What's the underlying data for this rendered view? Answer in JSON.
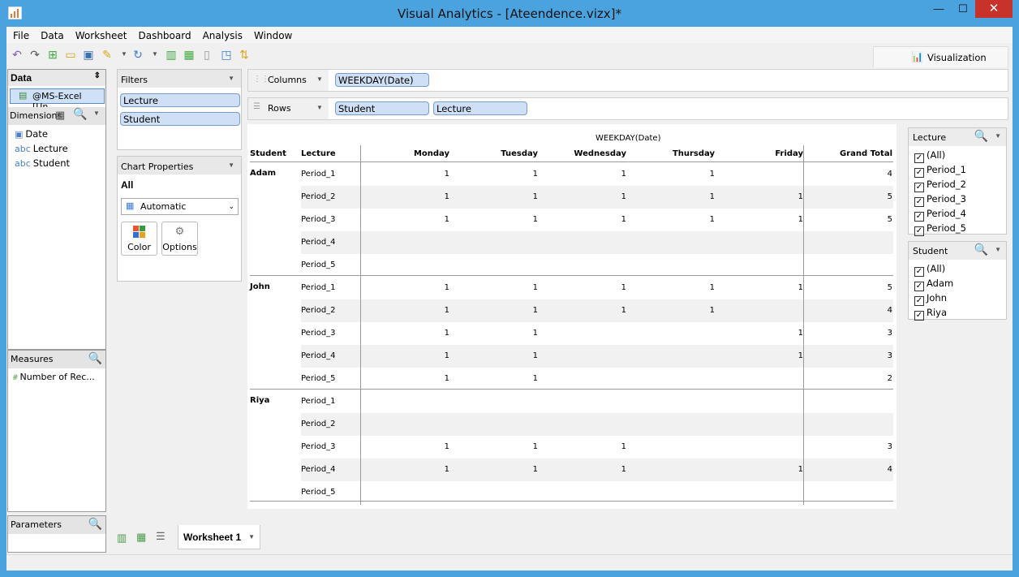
{
  "window": {
    "title": "Visual Analytics - [Ateendence.vizx]*",
    "minimize": "—",
    "maximize": "☐",
    "close": "✕"
  },
  "menu": [
    "File",
    "Data",
    "Worksheet",
    "Dashboard",
    "Analysis",
    "Window"
  ],
  "toolbar": {
    "viz_label": "Visualization"
  },
  "data_panel": {
    "header": "Data",
    "source": "@MS-Excel [Un...",
    "dimensions_label": "Dimensions",
    "dimensions": [
      {
        "type": "date",
        "label": "Date"
      },
      {
        "type": "abc",
        "label": "Lecture"
      },
      {
        "type": "abc",
        "label": "Student"
      }
    ],
    "measures_label": "Measures",
    "measures": [
      {
        "type": "num",
        "label": "Number of Rec..."
      }
    ],
    "parameters_label": "Parameters"
  },
  "filters": {
    "header": "Filters",
    "items": [
      "Lecture",
      "Student"
    ]
  },
  "chart_properties": {
    "header": "Chart Properties",
    "all_label": "All",
    "mark_type": "Automatic",
    "color_label": "Color",
    "options_label": "Options"
  },
  "shelves": {
    "columns_label": "Columns",
    "columns": [
      "WEEKDAY(Date)"
    ],
    "rows_label": "Rows",
    "rows": [
      "Student",
      "Lecture"
    ]
  },
  "table": {
    "top_header": "WEEKDAY(Date)",
    "headers": [
      "Student",
      "Lecture",
      "Monday",
      "Tuesday",
      "Wednesday",
      "Thursday",
      "Friday",
      "Grand Total"
    ],
    "groups": [
      {
        "student": "Adam",
        "rows": [
          {
            "lecture": "Period_1",
            "values": [
              "1",
              "1",
              "1",
              "1",
              "",
              "4"
            ]
          },
          {
            "lecture": "Period_2",
            "values": [
              "1",
              "1",
              "1",
              "1",
              "1",
              "5"
            ]
          },
          {
            "lecture": "Period_3",
            "values": [
              "1",
              "1",
              "1",
              "1",
              "1",
              "5"
            ]
          },
          {
            "lecture": "Period_4",
            "values": [
              "",
              "",
              "",
              "",
              "",
              ""
            ]
          },
          {
            "lecture": "Period_5",
            "values": [
              "",
              "",
              "",
              "",
              "",
              ""
            ]
          }
        ]
      },
      {
        "student": "John",
        "rows": [
          {
            "lecture": "Period_1",
            "values": [
              "1",
              "1",
              "1",
              "1",
              "1",
              "5"
            ]
          },
          {
            "lecture": "Period_2",
            "values": [
              "1",
              "1",
              "1",
              "1",
              "",
              "4"
            ]
          },
          {
            "lecture": "Period_3",
            "values": [
              "1",
              "1",
              "",
              "",
              "1",
              "3"
            ]
          },
          {
            "lecture": "Period_4",
            "values": [
              "1",
              "1",
              "",
              "",
              "1",
              "3"
            ]
          },
          {
            "lecture": "Period_5",
            "values": [
              "1",
              "1",
              "",
              "",
              "",
              "2"
            ]
          }
        ]
      },
      {
        "student": "Riya",
        "rows": [
          {
            "lecture": "Period_1",
            "values": [
              "",
              "",
              "",
              "",
              "",
              ""
            ]
          },
          {
            "lecture": "Period_2",
            "values": [
              "",
              "",
              "",
              "",
              "",
              ""
            ]
          },
          {
            "lecture": "Period_3",
            "values": [
              "1",
              "1",
              "1",
              "",
              "",
              "3"
            ]
          },
          {
            "lecture": "Period_4",
            "values": [
              "1",
              "1",
              "1",
              "",
              "1",
              "4"
            ]
          },
          {
            "lecture": "Period_5",
            "values": [
              "",
              "",
              "",
              "",
              "",
              ""
            ]
          }
        ]
      }
    ]
  },
  "lecture_filter": {
    "header": "Lecture",
    "items": [
      "(All)",
      "Period_1",
      "Period_2",
      "Period_3",
      "Period_4",
      "Period_5"
    ]
  },
  "student_filter": {
    "header": "Student",
    "items": [
      "(All)",
      "Adam",
      "John",
      "Riya"
    ]
  },
  "sheet_tabs": {
    "active": "Worksheet 1"
  }
}
